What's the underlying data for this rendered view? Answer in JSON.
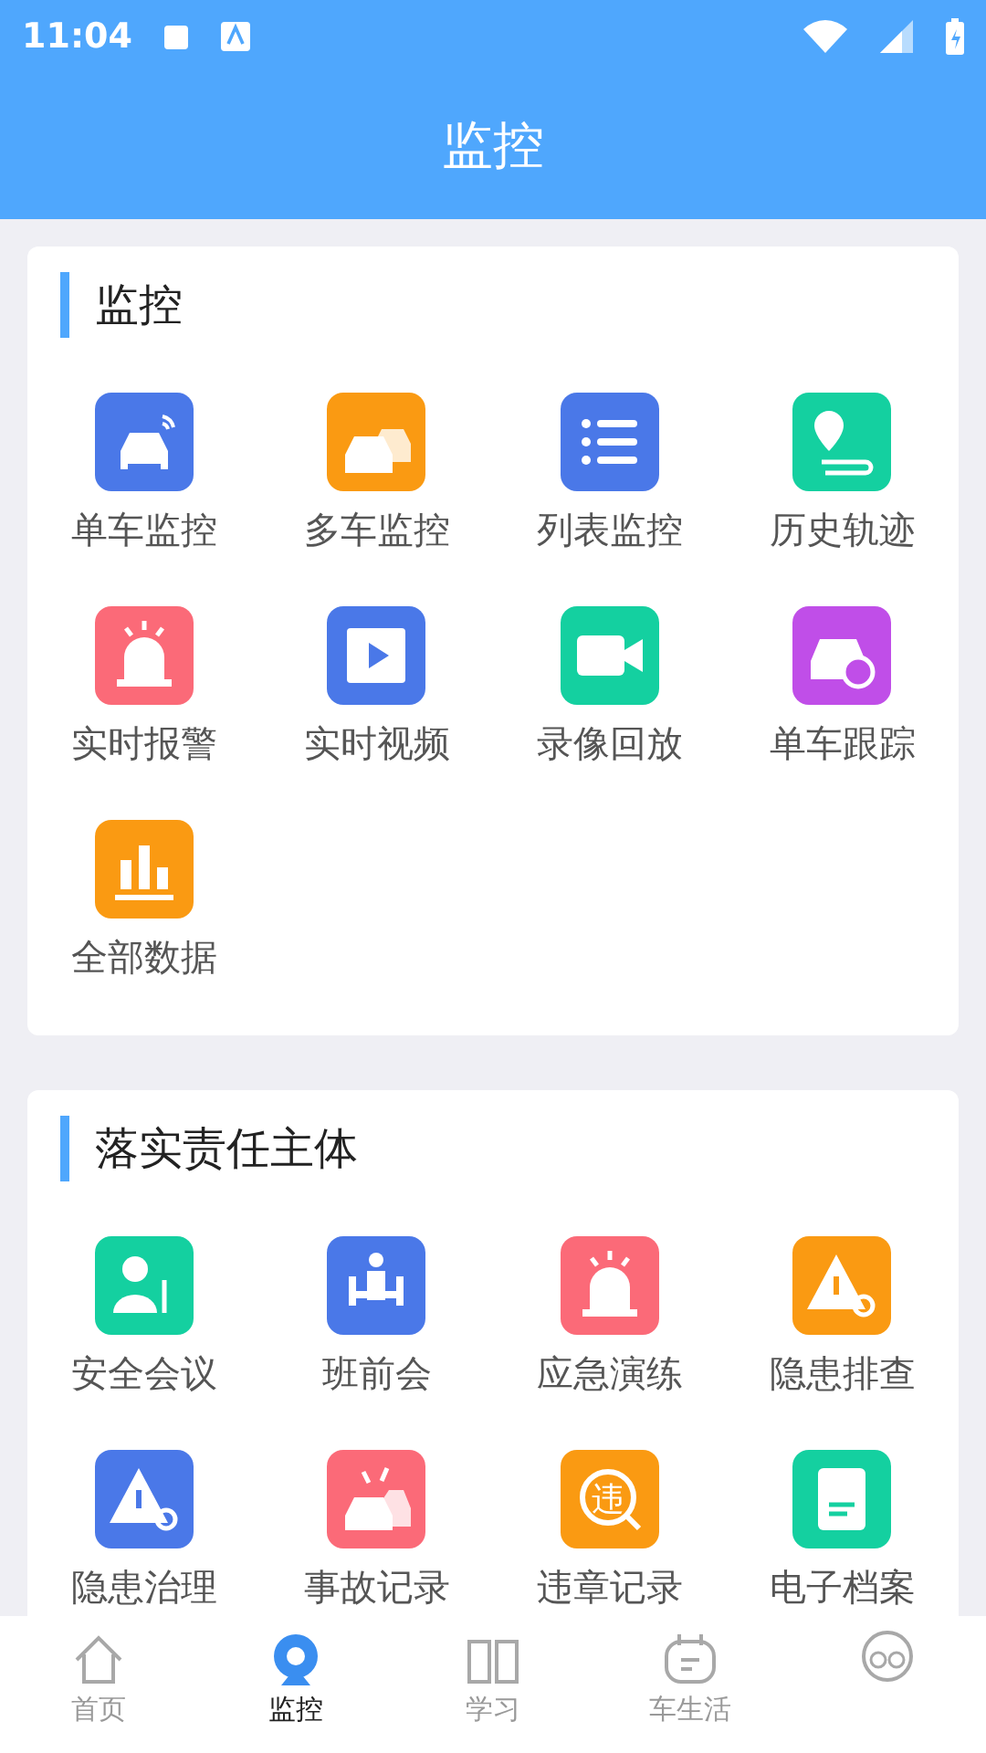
{
  "status_bar": {
    "time": "11:04"
  },
  "header": {
    "title": "监控"
  },
  "sections": [
    {
      "title": "监控",
      "items": [
        {
          "label": "单车监控",
          "kind": "car",
          "color": "#4a78e8"
        },
        {
          "label": "多车监控",
          "kind": "cars",
          "color": "#fa9a12"
        },
        {
          "label": "列表监控",
          "kind": "list",
          "color": "#4a78e8"
        },
        {
          "label": "历史轨迹",
          "kind": "route",
          "color": "#14d0a0"
        },
        {
          "label": "实时报警",
          "kind": "alarm",
          "color": "#fb6a78"
        },
        {
          "label": "实时视频",
          "kind": "video",
          "color": "#4a78e8"
        },
        {
          "label": "录像回放",
          "kind": "camera",
          "color": "#14d0a0"
        },
        {
          "label": "单车跟踪",
          "kind": "cartarget",
          "color": "#c04ee8"
        },
        {
          "label": "全部数据",
          "kind": "bars",
          "color": "#fa9a12"
        }
      ]
    },
    {
      "title": "落实责任主体",
      "items": [
        {
          "label": "安全会议",
          "kind": "speaker",
          "color": "#14d0a0"
        },
        {
          "label": "班前会",
          "kind": "meeting",
          "color": "#4a78e8"
        },
        {
          "label": "应急演练",
          "kind": "siren",
          "color": "#fb6a78"
        },
        {
          "label": "隐患排查",
          "kind": "warnsearch",
          "color": "#fa9a12"
        },
        {
          "label": "隐患治理",
          "kind": "warntool",
          "color": "#4a78e8"
        },
        {
          "label": "事故记录",
          "kind": "crash",
          "color": "#fb6a78"
        },
        {
          "label": "违章记录",
          "kind": "stamp",
          "icon_text": "违",
          "color": "#fa9a12"
        },
        {
          "label": "电子档案",
          "kind": "file",
          "color": "#14d0a0"
        }
      ]
    }
  ],
  "tabs": [
    {
      "label": "首页",
      "kind": "home",
      "selected": false
    },
    {
      "label": "监控",
      "kind": "webcam",
      "selected": true
    },
    {
      "label": "学习",
      "kind": "book",
      "selected": false
    },
    {
      "label": "车生活",
      "kind": "calendar",
      "selected": false
    },
    {
      "kind": "face",
      "selected": false
    }
  ]
}
